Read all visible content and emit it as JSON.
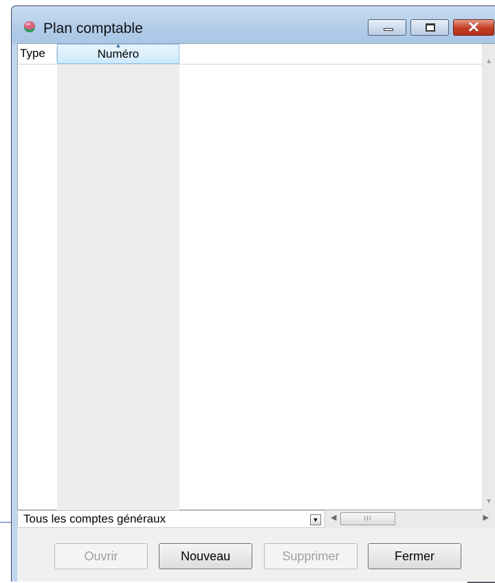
{
  "window": {
    "title": "Plan comptable",
    "close_glyph": "✕"
  },
  "list": {
    "columns": [
      {
        "label": "Type"
      },
      {
        "label": "Numéro",
        "sorted": "ascending"
      }
    ],
    "rows": []
  },
  "filter": {
    "selected": "Tous les comptes généraux",
    "arrow_glyph": "▼"
  },
  "scroll": {
    "thumb_glyph": "III"
  },
  "buttons": {
    "ouvrir": "Ouvrir",
    "nouveau": "Nouveau",
    "supprimer": "Supprimer",
    "fermer": "Fermer"
  },
  "icons": {
    "app": "ball-icon",
    "minimize": "minimize-icon",
    "maximize": "maximize-icon",
    "close": "close-icon"
  },
  "colors": {
    "titlebar": "#b3cde9",
    "close_button": "#c13d22",
    "sorted_header": "#cde9fb",
    "sorted_column": "#ededed"
  }
}
